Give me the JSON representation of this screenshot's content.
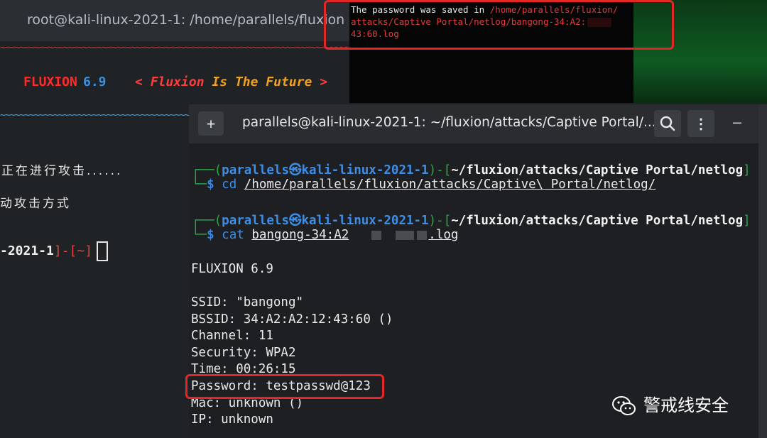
{
  "background_window": {
    "title": "root@kali-linux-2021-1: /home/parallels/fluxion",
    "wave_red": "~~~~~~~~~~~~~~~~~~~~~~~~~~~~~~~~~~~~~~~~~~~~~~~~~~~~~~~~~~~~~~~~~~~~~~~~~~~~~~~~",
    "wave_blue": "~~~~~~~~~~~~~~~~~~~~~~~~~~~~~~~~~~~~~~~~~~~~~~",
    "fluxion_name": "FLUXION",
    "fluxion_version": "6.9",
    "slogan_open": "<",
    "slogan_word1": "Fluxion",
    "slogan_word2": "Is",
    "slogan_word3": "The",
    "slogan_word4": "Future",
    "slogan_close": ">",
    "attacking_text": "正在进行攻击......",
    "attack_mode_text": "动攻击方式",
    "prompt_host": "-2021-1",
    "prompt_sep": "]-[",
    "prompt_dir": "~",
    "prompt_end": "]"
  },
  "popup": {
    "prefix": "The password was saved in ",
    "path_line1": "/home/parallels/fluxion/",
    "path_line2": "attacks/Captive Portal/netlog/bangong-34:A2:",
    "path_line3": "43:60.log"
  },
  "main_window": {
    "title": "parallels@kali-linux-2021-1: ~/fluxion/attacks/Captive Portal/...",
    "new_tab_icon": "+",
    "menu_icon": "⋮",
    "minimize_icon": "–",
    "prompt1": {
      "user": "parallels",
      "at": "㉿",
      "host": "kali-linux-2021-1",
      "cwd": "~/fluxion/attacks/Captive Portal/netlog",
      "command": "cd",
      "arg": "/home/parallels/fluxion/attacks/Captive\\ Portal/netlog/"
    },
    "prompt2": {
      "user": "parallels",
      "at": "㉿",
      "host": "kali-linux-2021-1",
      "cwd": "~/fluxion/attacks/Captive Portal/netlog",
      "command": "cat",
      "arg_start": "bangong-34:A2",
      "arg_end": ".log"
    },
    "output": {
      "header": "FLUXION 6.9",
      "ssid": "SSID: \"bangong\"",
      "bssid": "BSSID: 34:A2:A2:12:43:60 ()",
      "channel": "Channel: 11",
      "security": "Security: WPA2",
      "time": "Time: 00:26:15",
      "password": "Password: testpasswd@123",
      "mac": "Mac: unknown ()",
      "ip": "IP: unknown"
    }
  },
  "watermark": {
    "text": "警戒线安全",
    "icon": "wechat-icon"
  },
  "colors": {
    "highlight_box": "#e32626",
    "prompt_blue": "#3d8ee6",
    "prompt_green": "#27a84a",
    "fluxion_red": "#ff2a2a"
  }
}
